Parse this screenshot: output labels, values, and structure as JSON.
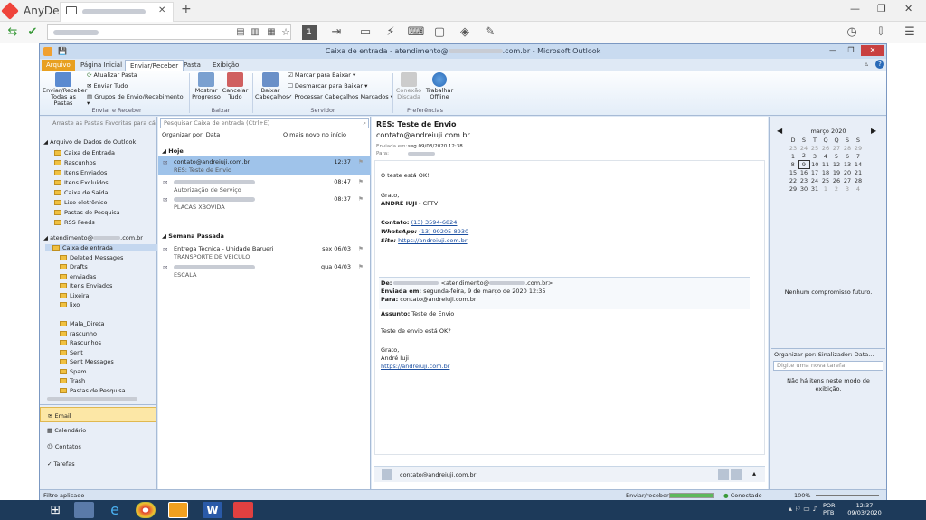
{
  "anydesk": {
    "title": "AnyDesk",
    "tab_label": "",
    "new_tab": "+",
    "address": "",
    "window_controls": {
      "min": "—",
      "max": "❐",
      "close": "✕"
    },
    "monitor_label": "1"
  },
  "outlook": {
    "title": "Caixa de entrada - atendimento@",
    "title_suffix": ".com.br - Microsoft Outlook",
    "ribbon_tabs": [
      "Arquivo",
      "Página Inicial",
      "Enviar/Receber",
      "Pasta",
      "Exibição"
    ],
    "ribbon": {
      "send_receive_all": "Enviar/Receber Todas as Pastas",
      "update_folder": "Atualizar Pasta",
      "send_all": "Enviar Tudo",
      "groups": "Grupos de Envio/Recebimento",
      "group_send": "Enviar e Receber",
      "show_progress": "Mostrar Progresso",
      "cancel_all": "Cancelar Tudo",
      "group_download": "Baixar",
      "download_headers": "Baixar Cabeçalhos",
      "mark_download": "Marcar para Baixar",
      "unmark_download": "Desmarcar para Baixar",
      "process_headers": "Processar Cabeçalhos Marcados",
      "group_server": "Servidor",
      "connection_offline": "Conexão Discada",
      "work_offline": "Trabalhar Offline",
      "group_prefs": "Preferências"
    },
    "nav": {
      "favorites": "Arraste as Pastas Favoritas para cá",
      "data_file": "Arquivo de Dados do Outlook",
      "data_folders": [
        "Caixa de Entrada",
        "Rascunhos",
        "Itens Enviados",
        "Itens Excluídos",
        "Caixa de Saída",
        "Lixo eletrônico",
        "Pastas de Pesquisa",
        "RSS Feeds"
      ],
      "account": "atendimento@",
      "account_suffix": ".com.br",
      "account_folders": [
        "Caixa de entrada",
        "Deleted Messages",
        "Drafts",
        "enviadas",
        "Itens Enviados",
        "Lixeira",
        "lixo",
        "Mala_Direta",
        "rascunho",
        "Rascunhos",
        "Sent",
        "Sent Messages",
        "Spam",
        "Trash",
        "Pastas de Pesquisa"
      ],
      "modules": [
        "Email",
        "Calendário",
        "Contatos",
        "Tarefas"
      ]
    },
    "list": {
      "search_placeholder": "Pesquisar Caixa de entrada (Ctrl+E)",
      "arrange": "Organizar por: Data",
      "order": "O mais novo no início",
      "group_today": "Hoje",
      "group_last_week": "Semana Passada",
      "items": [
        {
          "from": "contato@andreiuji.com.br",
          "subject": "RES: Teste de Envio",
          "time": "12:37",
          "selected": true
        },
        {
          "from": "",
          "subject": "Autorização de Serviço",
          "time": "08:47",
          "selected": false
        },
        {
          "from": "",
          "subject": "PLACAS XBOVIDA",
          "time": "08:37",
          "selected": false
        },
        {
          "from": "Entrega Tecnica - Unidade Barueri",
          "subject": "TRANSPORTE DE VEICULO",
          "time": "sex 06/03",
          "selected": false
        },
        {
          "from": "",
          "subject": "ESCALA",
          "time": "qua 04/03",
          "selected": false
        }
      ]
    },
    "reading": {
      "subject": "RES: Teste de Envio",
      "from": "contato@andreiuji.com.br",
      "sent_label": "Enviada em:",
      "sent_value": "seg 09/03/2020 12:38",
      "to_label": "Para:",
      "body_line1": "O teste está OK!",
      "greeting": "Grato,",
      "name": "ANDRÉ IUJI",
      "name_suffix": " - CFTV",
      "contact_label": "Contato:",
      "contact_phone": "(13) 3594-6824",
      "whatsapp_label": "WhatsApp:",
      "whatsapp_phone": "(13) 99205-8930",
      "site_label": "Site:",
      "site_url": "https://andreiuji.com.br",
      "q_de": "De:",
      "q_from_suffix": "<atendimento@",
      "q_from_end": ".com.br>",
      "q_sent_label": "Enviada em:",
      "q_sent": "segunda-feira, 9 de março de 2020 12:35",
      "q_to_label": "Para:",
      "q_to": "contato@andreiuji.com.br",
      "q_subject_label": "Assunto:",
      "q_subject": "Teste de Envio",
      "q_body": "Teste de envio está OK?",
      "q_greeting": "Grato,",
      "q_name": "André Iuji",
      "q_url": "https://andreiuji.com.br",
      "people_pane": "contato@andreiuji.com.br"
    },
    "todo": {
      "month": "março 2020",
      "weekdays": [
        "D",
        "S",
        "T",
        "Q",
        "Q",
        "S",
        "S"
      ],
      "weeks": [
        [
          "23",
          "24",
          "25",
          "26",
          "27",
          "28",
          "29"
        ],
        [
          "1",
          "2",
          "3",
          "4",
          "5",
          "6",
          "7"
        ],
        [
          "8",
          "9",
          "10",
          "11",
          "12",
          "13",
          "14"
        ],
        [
          "15",
          "16",
          "17",
          "18",
          "19",
          "20",
          "21"
        ],
        [
          "22",
          "23",
          "24",
          "25",
          "26",
          "27",
          "28"
        ],
        [
          "29",
          "30",
          "31",
          "1",
          "2",
          "3",
          "4"
        ]
      ],
      "no_appointments": "Nenhum compromisso futuro.",
      "arrange": "Organizar por: Sinalizador: Data...",
      "new_task_placeholder": "Digite uma nova tarefa",
      "no_items": "Não há itens neste modo de exibição."
    },
    "status": {
      "filter": "Filtro aplicado",
      "send_receive": "Enviar/receber",
      "connected": "Conectado",
      "zoom": "100%"
    }
  },
  "taskbar": {
    "lang": "POR",
    "lang2": "PTB",
    "time": "12:37",
    "date": "09/03/2020"
  }
}
